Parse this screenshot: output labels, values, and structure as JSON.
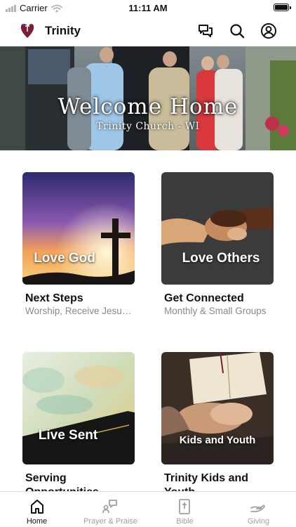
{
  "status_bar": {
    "carrier": "Carrier",
    "time": "11:11 AM"
  },
  "header": {
    "title": "Trinity",
    "icons": [
      "chat-icon",
      "search-icon",
      "account-icon"
    ]
  },
  "hero": {
    "title": "Welcome Home",
    "subtitle": "Trinity Church - WI"
  },
  "cards": [
    {
      "image_text": "Love God",
      "title": "Next Steps",
      "subtitle": "Worship, Receive Jesus, Baptism"
    },
    {
      "image_text": "Love Others",
      "title": "Get Connected",
      "subtitle": "Monthly & Small Groups"
    },
    {
      "image_text": "Live Sent",
      "title": "Serving Opportunities",
      "subtitle": ""
    },
    {
      "image_text": "Kids and Youth",
      "title": "Trinity Kids and Youth",
      "subtitle": ""
    }
  ],
  "tabs": [
    {
      "label": "Home",
      "icon": "home-icon",
      "active": true
    },
    {
      "label": "Prayer & Praise",
      "icon": "prayer-icon",
      "active": false
    },
    {
      "label": "Bible",
      "icon": "bible-icon",
      "active": false
    },
    {
      "label": "Giving",
      "icon": "giving-icon",
      "active": false
    }
  ],
  "colors": {
    "active_tab": "#111111",
    "inactive_tab": "#a0a0a0",
    "subtitle_gray": "#8a8a8a"
  }
}
